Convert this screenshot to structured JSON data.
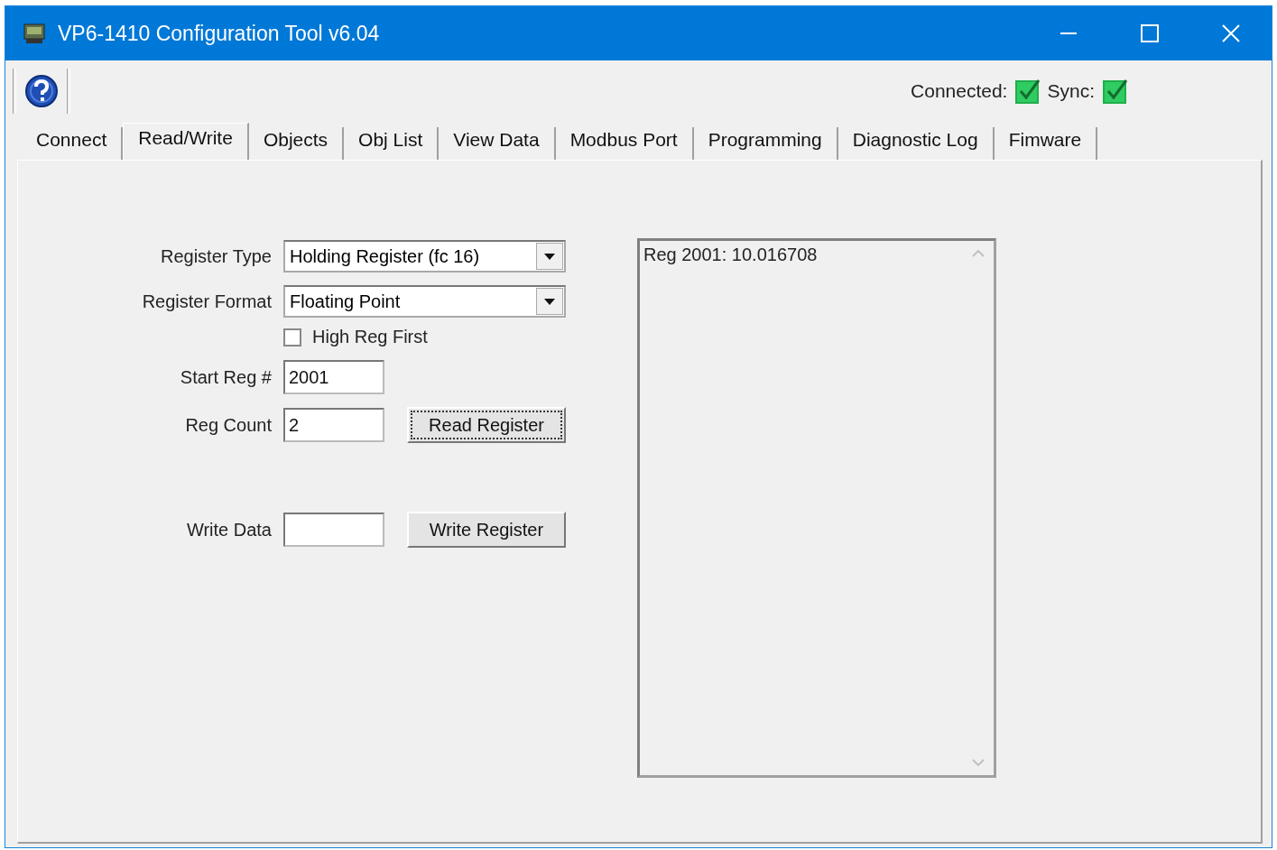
{
  "window": {
    "title": "VP6-1410 Configuration Tool v6.04"
  },
  "toolbar": {
    "status": [
      {
        "label": "Connected:",
        "checked": true
      },
      {
        "label": "Sync:",
        "checked": true
      }
    ]
  },
  "tabs": [
    {
      "label": "Connect",
      "selected": false
    },
    {
      "label": "Read/Write",
      "selected": true
    },
    {
      "label": "Objects",
      "selected": false
    },
    {
      "label": "Obj List",
      "selected": false
    },
    {
      "label": "View Data",
      "selected": false
    },
    {
      "label": "Modbus Port",
      "selected": false
    },
    {
      "label": "Programming",
      "selected": false
    },
    {
      "label": "Diagnostic Log",
      "selected": false
    },
    {
      "label": "Fimware",
      "selected": false
    }
  ],
  "form": {
    "register_type": {
      "label": "Register Type",
      "value": "Holding Register (fc 16)"
    },
    "register_format": {
      "label": "Register Format",
      "value": "Floating Point"
    },
    "high_reg_first": {
      "label": "High Reg First",
      "checked": false
    },
    "start_reg": {
      "label": "Start Reg #",
      "value": "2001"
    },
    "reg_count": {
      "label": "Reg Count",
      "value": "2"
    },
    "read_button": {
      "label": "Read Register",
      "focused": true
    },
    "write_data": {
      "label": "Write Data"
    },
    "write_button": {
      "label": "Write Register",
      "focused": false
    }
  },
  "output": {
    "lines": [
      "Reg 2001: 10.016708"
    ]
  }
}
